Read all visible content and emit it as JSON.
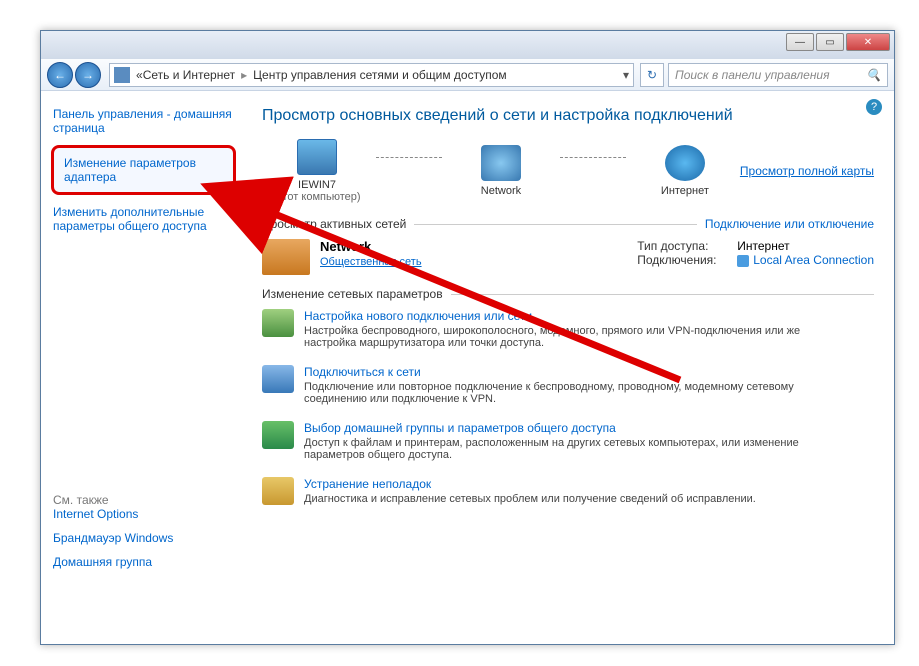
{
  "titlebar": {
    "min": "—",
    "max": "▭",
    "close": "✕"
  },
  "nav": {
    "back": "←",
    "forward": "→",
    "addr_seg1": "Сеть и Интернет",
    "addr_seg2": "Центр управления сетями и общим доступом",
    "sep": "▸",
    "refresh": "↻",
    "search_placeholder": "Поиск в панели управления",
    "search_icon": "🔍"
  },
  "sidebar": {
    "home": "Панель управления - домашняя страница",
    "adapter": "Изменение параметров адаптера",
    "sharing": "Изменить дополнительные параметры общего доступа",
    "seealso_label": "См. также",
    "internet_options": "Internet Options",
    "firewall": "Брандмауэр Windows",
    "homegroup": "Домашняя группа"
  },
  "help": "?",
  "content": {
    "heading": "Просмотр основных сведений о сети и настройка подключений",
    "viewmap": "Просмотр полной карты",
    "overview": {
      "computer_name": "IEWIN7",
      "computer_sub": "(этот компьютер)",
      "network_label": "Network",
      "internet_label": "Интернет"
    },
    "active": {
      "title": "Просмотр активных сетей",
      "link": "Подключение или отключение",
      "name": "Network",
      "category": "Общественная сеть",
      "access_lbl": "Тип доступа:",
      "access_val": "Интернет",
      "conn_lbl": "Подключения:",
      "conn_val": "Local Area Connection"
    },
    "change": {
      "title": "Изменение сетевых параметров",
      "items": [
        {
          "title": "Настройка нового подключения или сети",
          "desc": "Настройка беспроводного, широкополосного, модемного, прямого или VPN-подключения или же настройка маршрутизатора или точки доступа."
        },
        {
          "title": "Подключиться к сети",
          "desc": "Подключение или повторное подключение к беспроводному, проводному, модемному сетевому соединению или подключение к VPN."
        },
        {
          "title": "Выбор домашней группы и параметров общего доступа",
          "desc": "Доступ к файлам и принтерам, расположенным на других сетевых компьютерах, или изменение параметров общего доступа."
        },
        {
          "title": "Устранение неполадок",
          "desc": "Диагностика и исправление сетевых проблем или получение сведений об исправлении."
        }
      ]
    }
  }
}
